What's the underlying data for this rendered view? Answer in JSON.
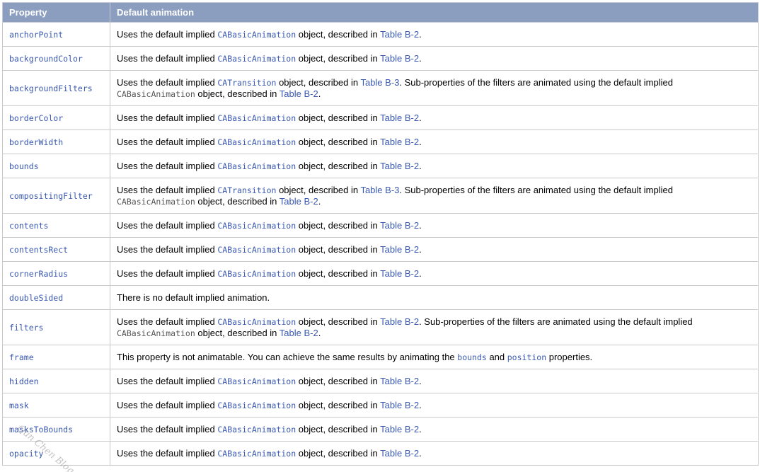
{
  "header": {
    "property": "Property",
    "default_animation": "Default animation"
  },
  "common": {
    "uses": "Uses the default implied ",
    "object_described_in": " object, described in ",
    "period": ".",
    "sub_props": ". Sub-properties of the filters are animated using the default implied ",
    "ca_basic": "CABasicAnimation",
    "ca_transition": "CATransition",
    "table_b2": "Table B-2",
    "table_b3": "Table B-3"
  },
  "rows": [
    {
      "property": "anchorPoint"
    },
    {
      "property": "backgroundColor"
    },
    {
      "property": "backgroundFilters"
    },
    {
      "property": "borderColor"
    },
    {
      "property": "borderWidth"
    },
    {
      "property": "bounds"
    },
    {
      "property": "compositingFilter"
    },
    {
      "property": "contents"
    },
    {
      "property": "contentsRect"
    },
    {
      "property": "cornerRadius"
    },
    {
      "property": "doubleSided",
      "text": "There is no default implied animation."
    },
    {
      "property": "filters"
    },
    {
      "property": "frame",
      "text_a": "This property is not animatable. You can achieve the same results by animating the ",
      "code_a": "bounds",
      "text_b": " and ",
      "code_b": "position",
      "text_c": " properties."
    },
    {
      "property": "hidden"
    },
    {
      "property": "mask"
    },
    {
      "property": "masksToBounds"
    },
    {
      "property": "opacity"
    }
  ],
  "watermark": "Qun Chen Blog"
}
